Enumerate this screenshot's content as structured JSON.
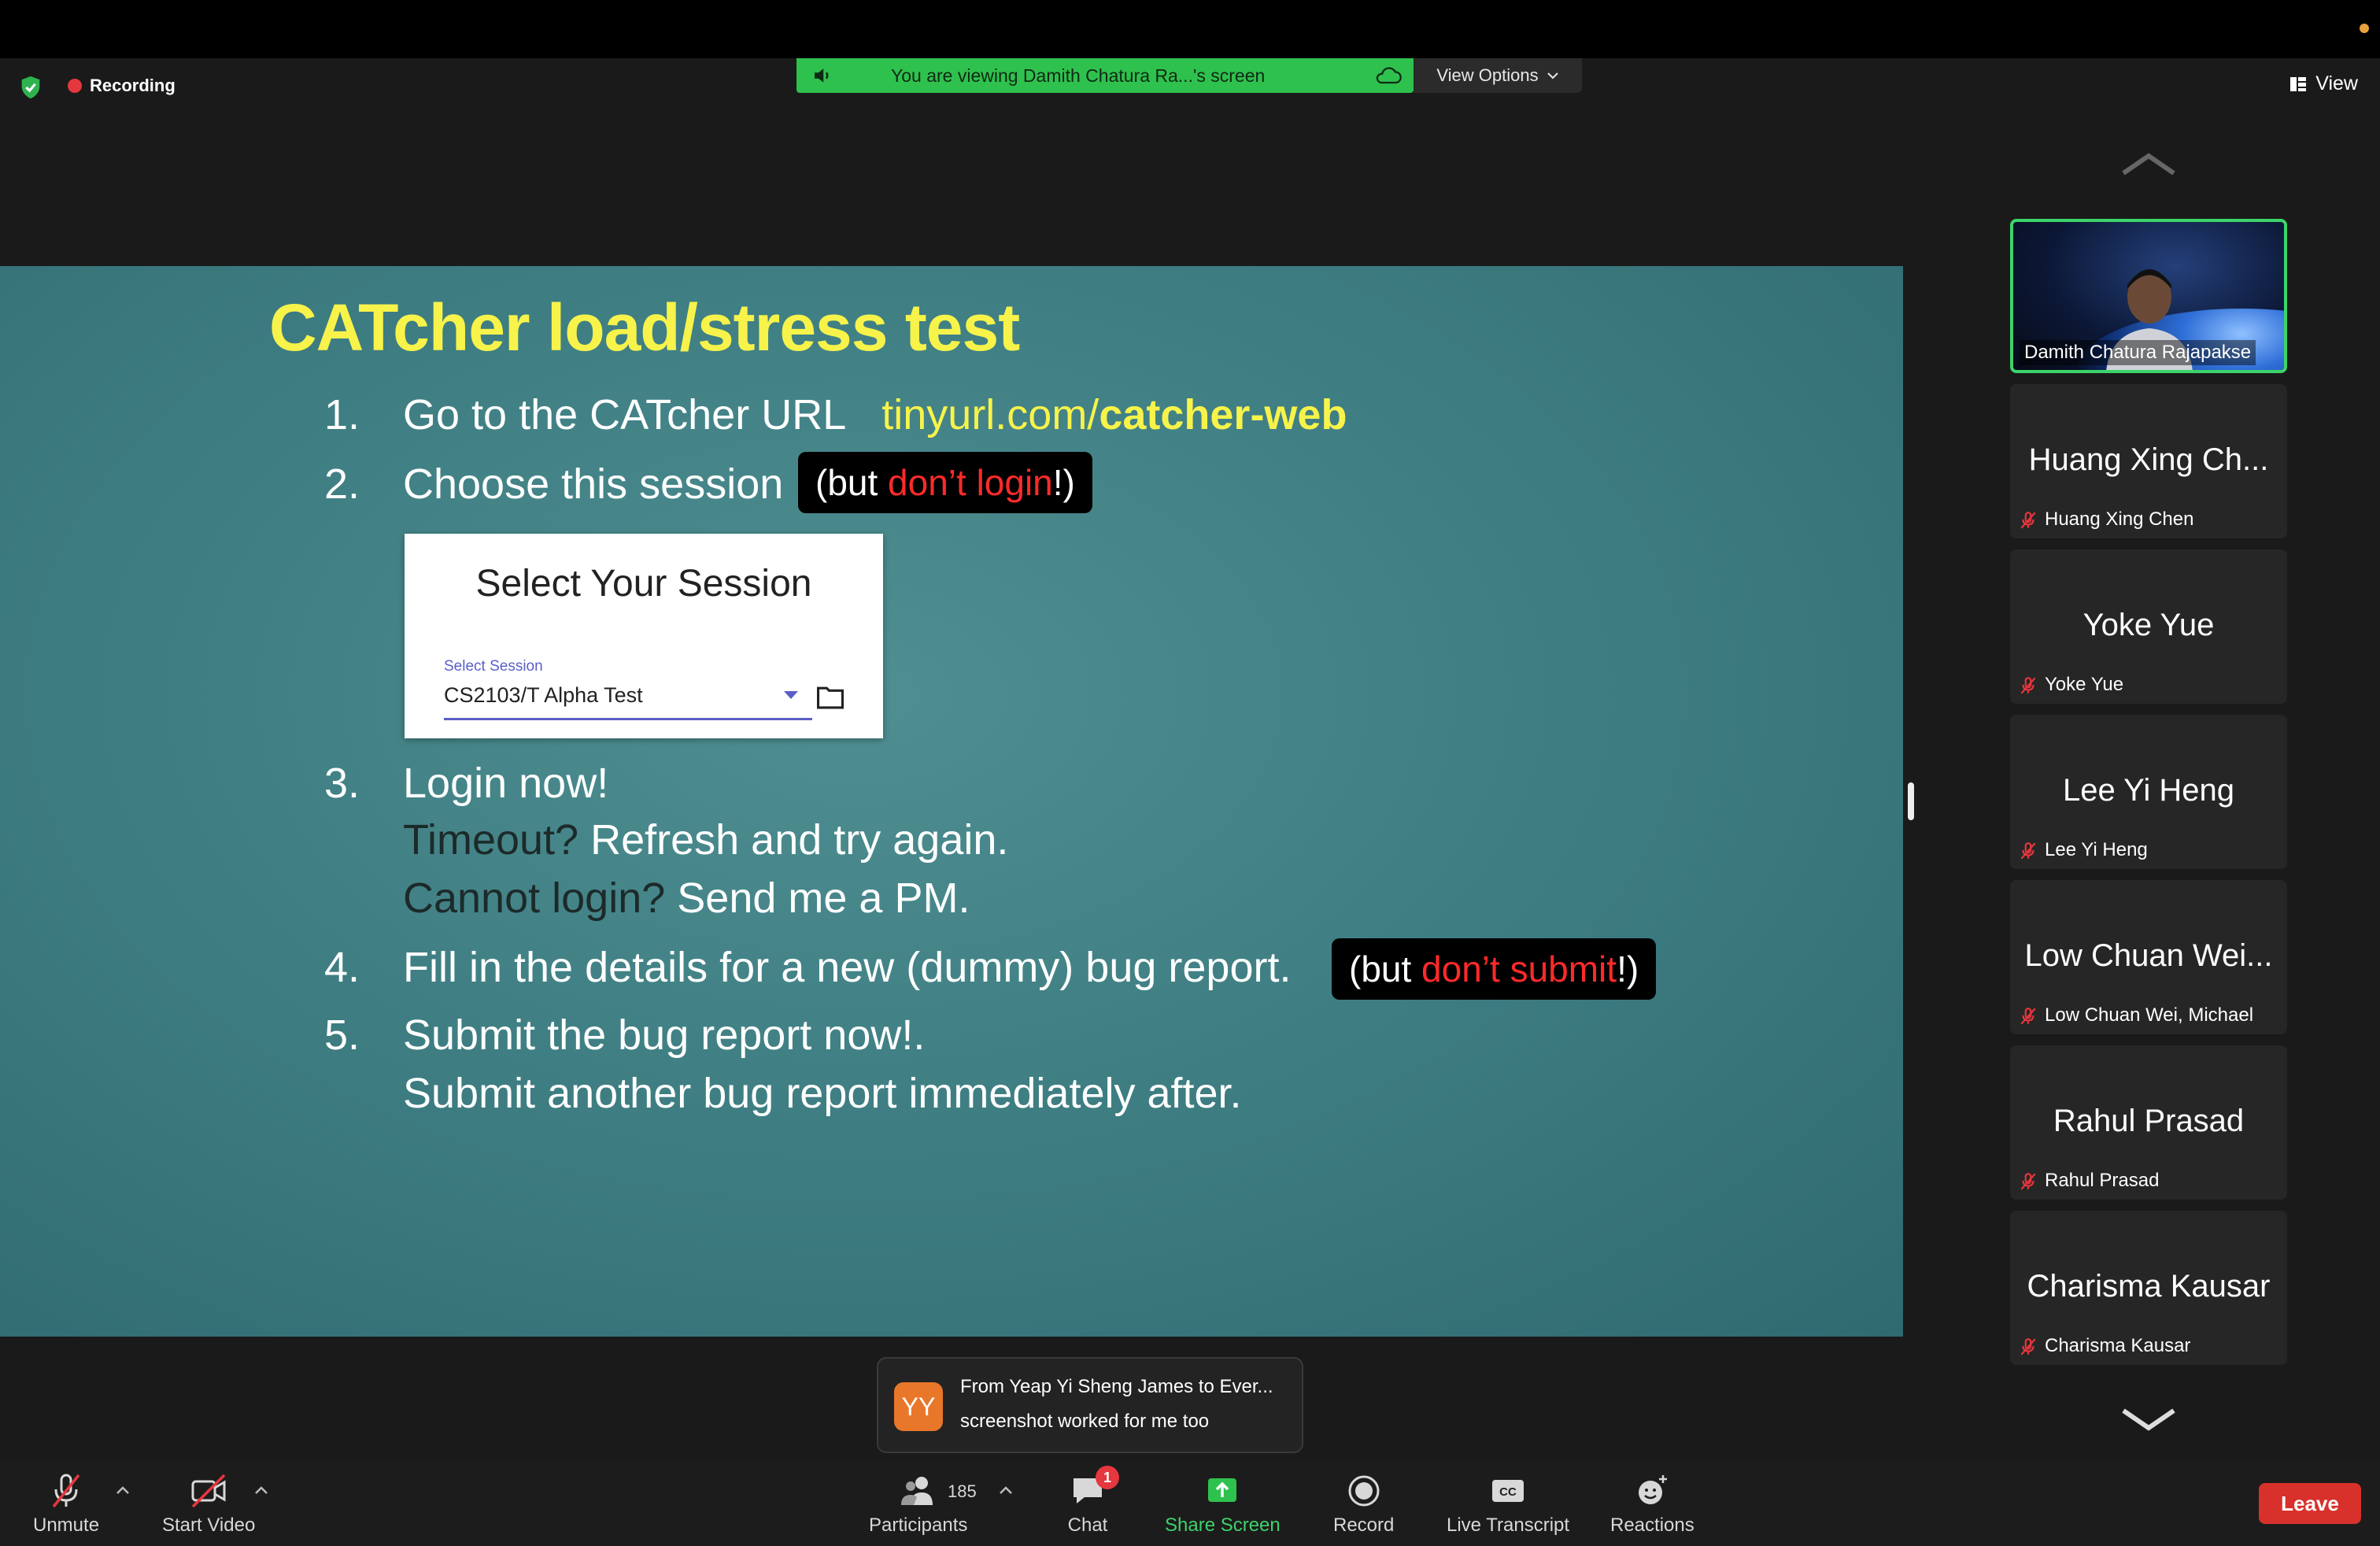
{
  "topbar": {
    "recording_label": "Recording",
    "banner_text": "You are viewing Damith Chatura Ra...'s screen",
    "view_options_label": "View Options",
    "view_label": "View"
  },
  "slide": {
    "title": "CATcher load/stress test",
    "steps": [
      {
        "num": "1.",
        "text": "Go to the CATcher URL",
        "link_a": "tinyurl.com/",
        "link_b": "catcher-web"
      },
      {
        "num": "2.",
        "text": "Choose this session",
        "note_pre": "(but ",
        "note_red": "don’t login",
        "note_post": "!)"
      },
      {
        "num": "3.",
        "text": "Login now!",
        "line2_dark": "Timeout?",
        "line2_rest": " Refresh and try again.",
        "line3_dark": "Cannot login?",
        "line3_rest": " Send me a PM."
      },
      {
        "num": "4.",
        "text": "Fill in the details for a new (dummy) bug report.",
        "note_pre": "(but ",
        "note_red": "don’t submit",
        "note_post": "!)"
      },
      {
        "num": "5.",
        "text": "Submit the bug report now!.",
        "line2": "Submit another bug report immediately after."
      }
    ],
    "session_card": {
      "title": "Select Your Session",
      "label": "Select Session",
      "value": "CS2103/T Alpha Test"
    }
  },
  "participants_panel": {
    "active": {
      "name": "Damith Chatura Rajapakse"
    },
    "tiles": [
      {
        "big": "Huang Xing Ch...",
        "small": "Huang Xing Chen"
      },
      {
        "big": "Yoke Yue",
        "small": "Yoke Yue"
      },
      {
        "big": "Lee Yi Heng",
        "small": "Lee Yi Heng"
      },
      {
        "big": "Low Chuan Wei...",
        "small": "Low Chuan Wei, Michael"
      },
      {
        "big": "Rahul Prasad",
        "small": "Rahul Prasad"
      },
      {
        "big": "Charisma Kausar",
        "small": "Charisma Kausar"
      }
    ]
  },
  "chat_toast": {
    "avatar": "YY",
    "from": "From Yeap Yi Sheng James to Ever...",
    "message": "screenshot worked for me too"
  },
  "toolbar": {
    "unmute": "Unmute",
    "start_video": "Start Video",
    "participants": "Participants",
    "participants_count": "185",
    "chat": "Chat",
    "chat_badge": "1",
    "share_screen": "Share Screen",
    "record": "Record",
    "live_transcript": "Live Transcript",
    "reactions": "Reactions",
    "leave": "Leave"
  },
  "colors": {
    "banner_green": "#2fc14e",
    "slide_title_yellow": "#f7f34a",
    "note_red": "#ff2a2a",
    "active_tile_border": "#3cd46a",
    "leave_red": "#d8312b"
  }
}
